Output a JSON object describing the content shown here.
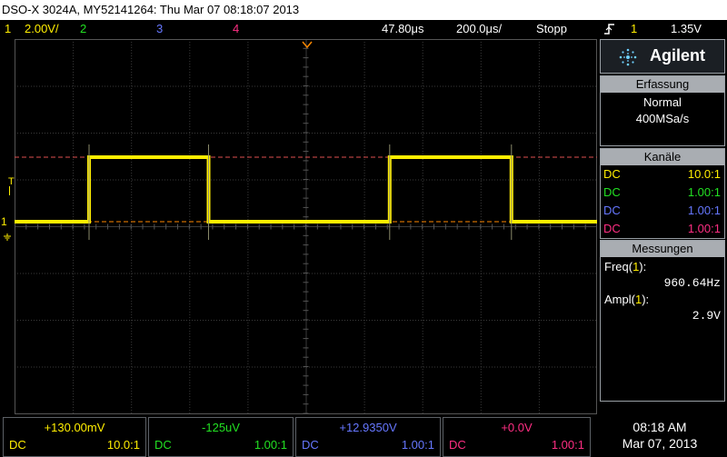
{
  "window": {
    "title": "DSO-X 3024A, MY52141264: Thu Mar 07 08:18:07 2013"
  },
  "colors": {
    "ch1": "#ffee00",
    "ch2": "#22e022",
    "ch3": "#6677ff",
    "ch4": "#ff2e83",
    "grid": "#3a3a3a",
    "trigger_marker": "#ff8800",
    "cursor_line": "#e05050"
  },
  "top": {
    "ch1_num": "1",
    "ch1_scale": "2.00V/",
    "ch2_num": "2",
    "ch3_num": "3",
    "ch4_num": "4",
    "delay": "47.80μs",
    "timebase": "200.0μs/",
    "run_state": "Stopp",
    "trig_icon": "rising-edge-trigger-icon",
    "trig_channel": "1",
    "trig_level": "1.35V"
  },
  "screen": {
    "ch1_marker": "1",
    "trigger_level_marker": "T",
    "waveform": {
      "type": "square",
      "channel": "1",
      "frequency_hz": 960.64,
      "amplitude_v": 2.9,
      "transitions_fraction": [
        0.128,
        0.333,
        0.644,
        0.853,
        1.0
      ],
      "start_high": false
    }
  },
  "panel": {
    "brand": "Agilent",
    "acq": {
      "header": "Erfassung",
      "mode": "Normal",
      "rate": "400MSa/s"
    },
    "channels": {
      "header": "Kanäle",
      "rows": [
        {
          "coupling": "DC",
          "probe": "10.0:1"
        },
        {
          "coupling": "DC",
          "probe": "1.00:1"
        },
        {
          "coupling": "DC",
          "probe": "1.00:1"
        },
        {
          "coupling": "DC",
          "probe": "1.00:1"
        }
      ]
    },
    "meas": {
      "header": "Messungen",
      "freq_label": "Freq(",
      "freq_ch": "1",
      "freq_close": "):",
      "freq_value": "960.64Hz",
      "ampl_label": "Ampl(",
      "ampl_ch": "1",
      "ampl_close": "):",
      "ampl_value": "2.9V"
    }
  },
  "bottom": {
    "ch": [
      {
        "offset": "+130.00mV",
        "coupling": "DC",
        "probe": "10.0:1"
      },
      {
        "offset": "-125uV",
        "coupling": "DC",
        "probe": "1.00:1"
      },
      {
        "offset": "+12.9350V",
        "coupling": "DC",
        "probe": "1.00:1"
      },
      {
        "offset": "+0.0V",
        "coupling": "DC",
        "probe": "1.00:1"
      }
    ],
    "time": "08:18 AM",
    "date": "Mar 07, 2013"
  }
}
